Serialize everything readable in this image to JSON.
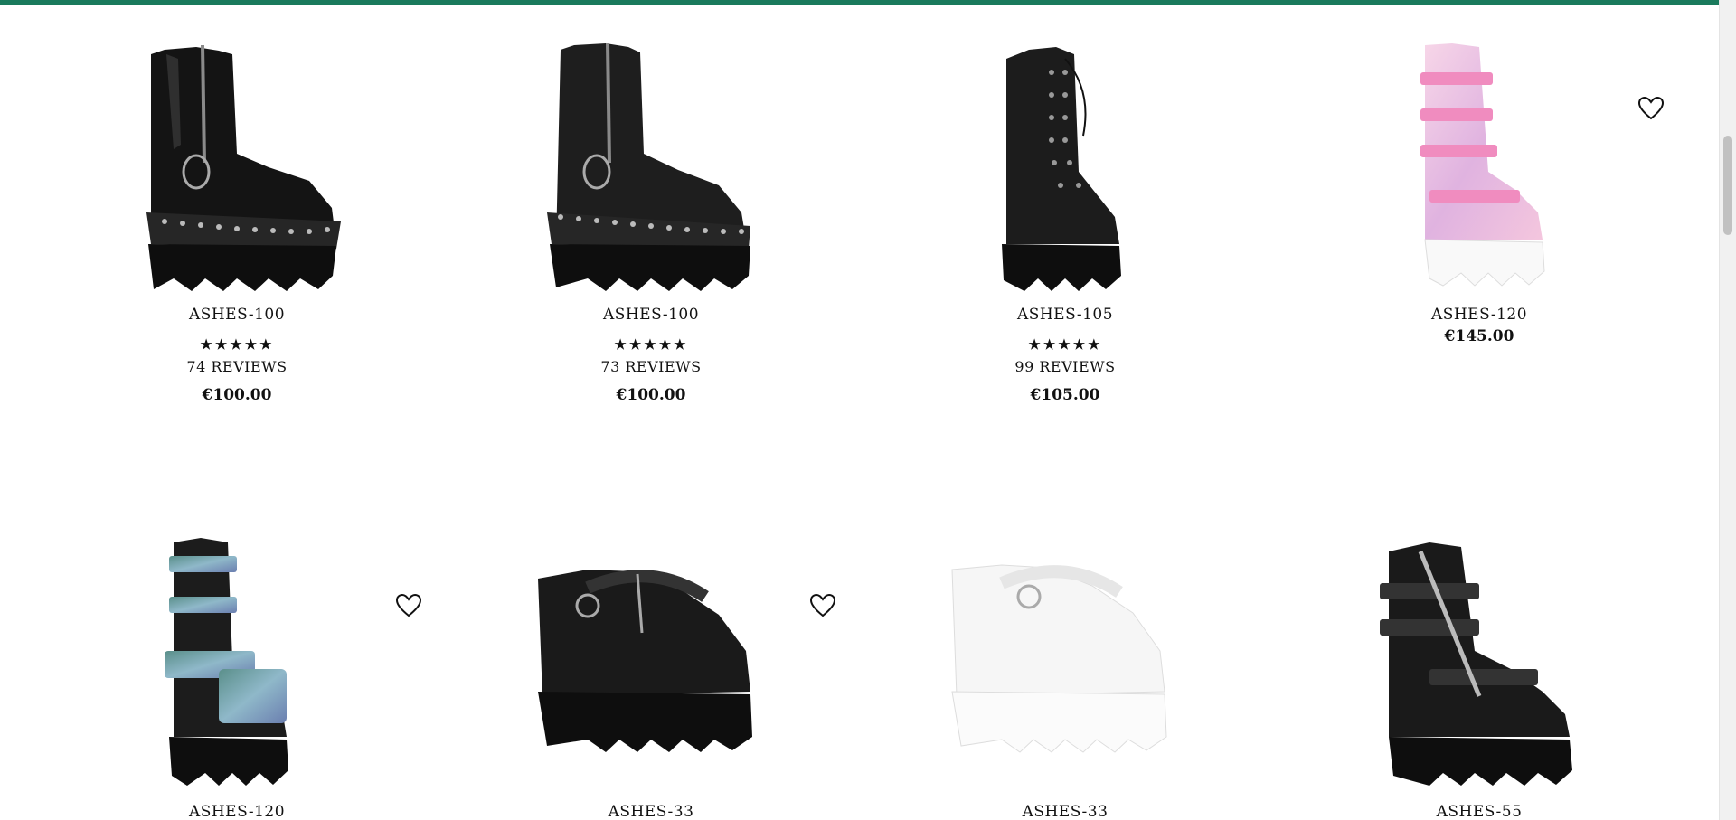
{
  "colors": {
    "topbar": "#1a7a5c",
    "text": "#111111",
    "boot_black": "#1c1c1c",
    "boot_white": "#f2f2f2",
    "boot_pink": "#f0b7d6",
    "boot_holo": "#7fc4b8"
  },
  "products": [
    {
      "name": "ASHES-100",
      "stars": "★★★★★",
      "reviews": "74 REVIEWS",
      "price": "€100.00",
      "rating": 5,
      "variant": "black-patent",
      "wishlist": false
    },
    {
      "name": "ASHES-100",
      "stars": "★★★★★",
      "reviews": "73 REVIEWS",
      "price": "€100.00",
      "rating": 5,
      "variant": "black-suede",
      "wishlist": false
    },
    {
      "name": "ASHES-105",
      "stars": "★★★★★",
      "reviews": "99 REVIEWS",
      "price": "€105.00",
      "rating": 5,
      "variant": "black-lace",
      "wishlist": false
    },
    {
      "name": "ASHES-120",
      "stars": "",
      "reviews": "",
      "price": "€145.00",
      "variant": "pink-holo",
      "wishlist": true,
      "wishlist_icon": "heart-outline-icon"
    },
    {
      "name": "ASHES-120",
      "stars": "",
      "reviews": "",
      "price": "",
      "variant": "holo-green",
      "wishlist": true,
      "wishlist_icon": "heart-outline-icon"
    },
    {
      "name": "ASHES-33",
      "stars": "",
      "reviews": "",
      "price": "",
      "variant": "black-maryjane",
      "wishlist": true,
      "wishlist_icon": "heart-outline-icon"
    },
    {
      "name": "ASHES-33",
      "stars": "",
      "reviews": "",
      "price": "",
      "variant": "white-maryjane",
      "wishlist": false
    },
    {
      "name": "ASHES-55",
      "stars": "",
      "reviews": "",
      "price": "",
      "variant": "black-bat",
      "wishlist": false
    }
  ]
}
